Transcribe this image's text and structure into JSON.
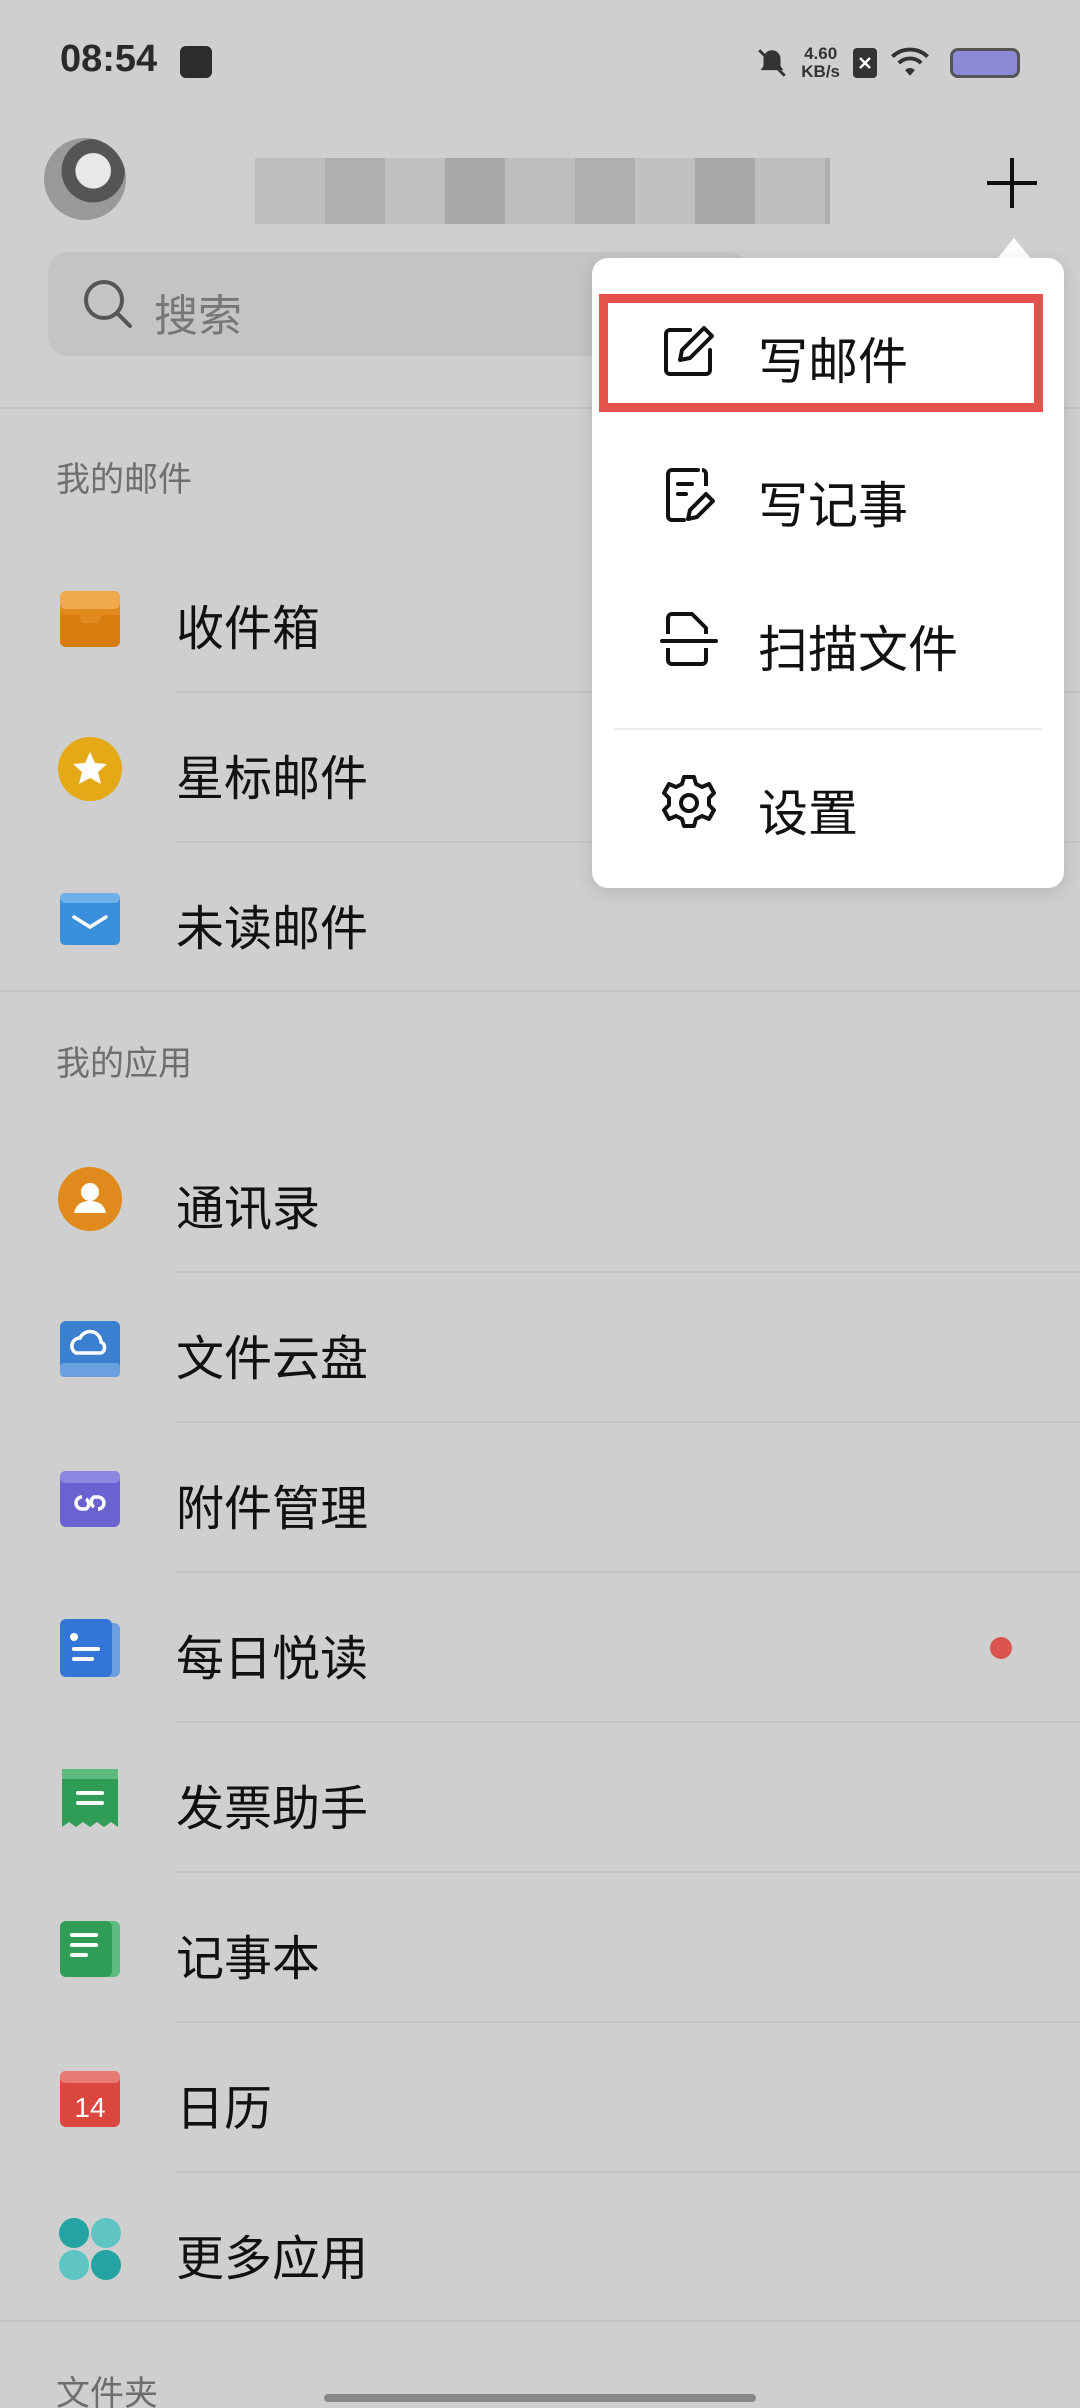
{
  "status_bar": {
    "time": "08:54",
    "net_speed_value": "4.60",
    "net_speed_unit": "KB/s"
  },
  "header": {
    "search_placeholder": "搜索"
  },
  "sections": {
    "my_mail": "我的邮件",
    "my_apps": "我的应用",
    "folders": "文件夹"
  },
  "mail_items": [
    {
      "label": "收件箱",
      "icon": "inbox-icon",
      "color": "#e08a1e"
    },
    {
      "label": "星标邮件",
      "icon": "star-icon",
      "color": "#e5a816"
    },
    {
      "label": "未读邮件",
      "icon": "unread-mail-icon",
      "color": "#3a8fdc"
    }
  ],
  "app_items": [
    {
      "label": "通讯录",
      "icon": "contacts-icon",
      "color": "#e0891c"
    },
    {
      "label": "文件云盘",
      "icon": "cloud-drive-icon",
      "color": "#3a7fd0"
    },
    {
      "label": "附件管理",
      "icon": "attachment-icon",
      "color": "#6a62d0"
    },
    {
      "label": "每日悦读",
      "icon": "daily-reading-icon",
      "color": "#3475d8",
      "badge": true
    },
    {
      "label": "发票助手",
      "icon": "invoice-icon",
      "color": "#2f9d55"
    },
    {
      "label": "记事本",
      "icon": "notebook-icon",
      "color": "#2f9d55"
    },
    {
      "label": "日历",
      "icon": "calendar-icon",
      "color": "#d9473f",
      "day": "14"
    },
    {
      "label": "更多应用",
      "icon": "more-apps-icon",
      "color": "#24a3a3"
    }
  ],
  "popup_menu": [
    {
      "label": "写邮件",
      "icon": "compose-mail-icon"
    },
    {
      "label": "写记事",
      "icon": "write-note-icon"
    },
    {
      "label": "扫描文件",
      "icon": "scan-document-icon"
    },
    {
      "label": "设置",
      "icon": "settings-gear-icon"
    }
  ]
}
